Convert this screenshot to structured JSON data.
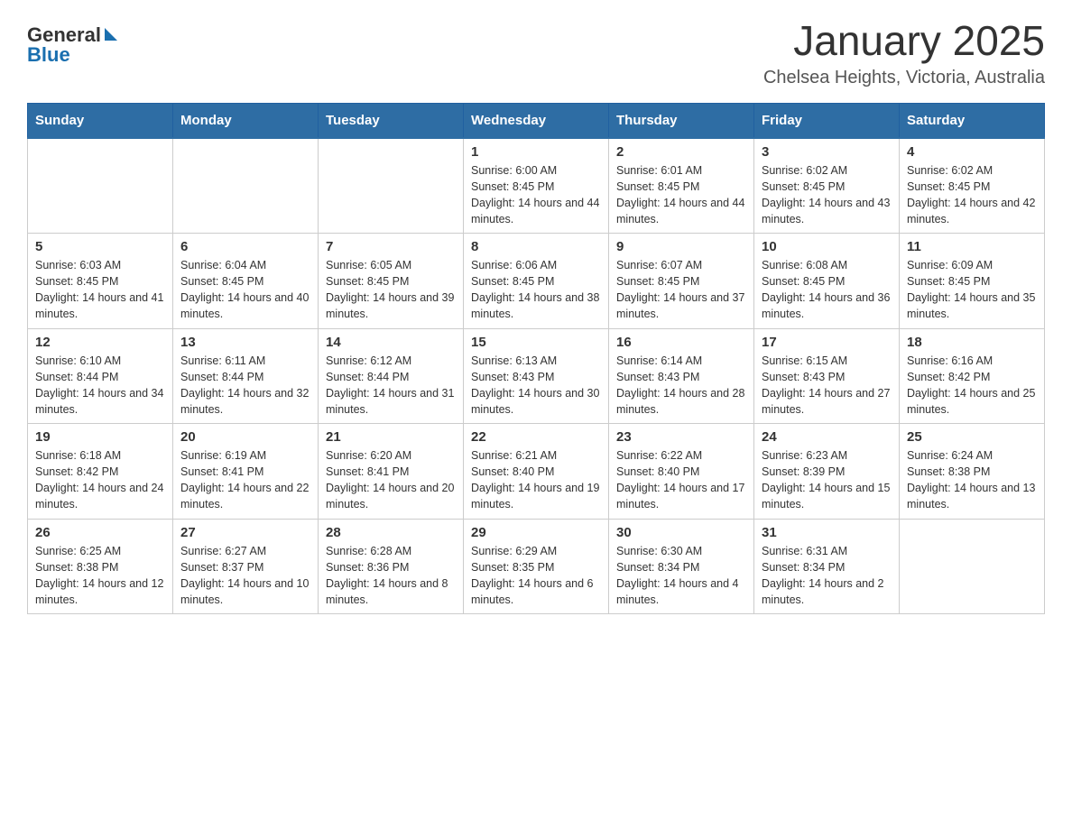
{
  "header": {
    "title": "January 2025",
    "subtitle": "Chelsea Heights, Victoria, Australia",
    "logo_general": "General",
    "logo_blue": "Blue"
  },
  "weekdays": [
    "Sunday",
    "Monday",
    "Tuesday",
    "Wednesday",
    "Thursday",
    "Friday",
    "Saturday"
  ],
  "weeks": [
    [
      {
        "day": "",
        "info": ""
      },
      {
        "day": "",
        "info": ""
      },
      {
        "day": "",
        "info": ""
      },
      {
        "day": "1",
        "info": "Sunrise: 6:00 AM\nSunset: 8:45 PM\nDaylight: 14 hours and 44 minutes."
      },
      {
        "day": "2",
        "info": "Sunrise: 6:01 AM\nSunset: 8:45 PM\nDaylight: 14 hours and 44 minutes."
      },
      {
        "day": "3",
        "info": "Sunrise: 6:02 AM\nSunset: 8:45 PM\nDaylight: 14 hours and 43 minutes."
      },
      {
        "day": "4",
        "info": "Sunrise: 6:02 AM\nSunset: 8:45 PM\nDaylight: 14 hours and 42 minutes."
      }
    ],
    [
      {
        "day": "5",
        "info": "Sunrise: 6:03 AM\nSunset: 8:45 PM\nDaylight: 14 hours and 41 minutes."
      },
      {
        "day": "6",
        "info": "Sunrise: 6:04 AM\nSunset: 8:45 PM\nDaylight: 14 hours and 40 minutes."
      },
      {
        "day": "7",
        "info": "Sunrise: 6:05 AM\nSunset: 8:45 PM\nDaylight: 14 hours and 39 minutes."
      },
      {
        "day": "8",
        "info": "Sunrise: 6:06 AM\nSunset: 8:45 PM\nDaylight: 14 hours and 38 minutes."
      },
      {
        "day": "9",
        "info": "Sunrise: 6:07 AM\nSunset: 8:45 PM\nDaylight: 14 hours and 37 minutes."
      },
      {
        "day": "10",
        "info": "Sunrise: 6:08 AM\nSunset: 8:45 PM\nDaylight: 14 hours and 36 minutes."
      },
      {
        "day": "11",
        "info": "Sunrise: 6:09 AM\nSunset: 8:45 PM\nDaylight: 14 hours and 35 minutes."
      }
    ],
    [
      {
        "day": "12",
        "info": "Sunrise: 6:10 AM\nSunset: 8:44 PM\nDaylight: 14 hours and 34 minutes."
      },
      {
        "day": "13",
        "info": "Sunrise: 6:11 AM\nSunset: 8:44 PM\nDaylight: 14 hours and 32 minutes."
      },
      {
        "day": "14",
        "info": "Sunrise: 6:12 AM\nSunset: 8:44 PM\nDaylight: 14 hours and 31 minutes."
      },
      {
        "day": "15",
        "info": "Sunrise: 6:13 AM\nSunset: 8:43 PM\nDaylight: 14 hours and 30 minutes."
      },
      {
        "day": "16",
        "info": "Sunrise: 6:14 AM\nSunset: 8:43 PM\nDaylight: 14 hours and 28 minutes."
      },
      {
        "day": "17",
        "info": "Sunrise: 6:15 AM\nSunset: 8:43 PM\nDaylight: 14 hours and 27 minutes."
      },
      {
        "day": "18",
        "info": "Sunrise: 6:16 AM\nSunset: 8:42 PM\nDaylight: 14 hours and 25 minutes."
      }
    ],
    [
      {
        "day": "19",
        "info": "Sunrise: 6:18 AM\nSunset: 8:42 PM\nDaylight: 14 hours and 24 minutes."
      },
      {
        "day": "20",
        "info": "Sunrise: 6:19 AM\nSunset: 8:41 PM\nDaylight: 14 hours and 22 minutes."
      },
      {
        "day": "21",
        "info": "Sunrise: 6:20 AM\nSunset: 8:41 PM\nDaylight: 14 hours and 20 minutes."
      },
      {
        "day": "22",
        "info": "Sunrise: 6:21 AM\nSunset: 8:40 PM\nDaylight: 14 hours and 19 minutes."
      },
      {
        "day": "23",
        "info": "Sunrise: 6:22 AM\nSunset: 8:40 PM\nDaylight: 14 hours and 17 minutes."
      },
      {
        "day": "24",
        "info": "Sunrise: 6:23 AM\nSunset: 8:39 PM\nDaylight: 14 hours and 15 minutes."
      },
      {
        "day": "25",
        "info": "Sunrise: 6:24 AM\nSunset: 8:38 PM\nDaylight: 14 hours and 13 minutes."
      }
    ],
    [
      {
        "day": "26",
        "info": "Sunrise: 6:25 AM\nSunset: 8:38 PM\nDaylight: 14 hours and 12 minutes."
      },
      {
        "day": "27",
        "info": "Sunrise: 6:27 AM\nSunset: 8:37 PM\nDaylight: 14 hours and 10 minutes."
      },
      {
        "day": "28",
        "info": "Sunrise: 6:28 AM\nSunset: 8:36 PM\nDaylight: 14 hours and 8 minutes."
      },
      {
        "day": "29",
        "info": "Sunrise: 6:29 AM\nSunset: 8:35 PM\nDaylight: 14 hours and 6 minutes."
      },
      {
        "day": "30",
        "info": "Sunrise: 6:30 AM\nSunset: 8:34 PM\nDaylight: 14 hours and 4 minutes."
      },
      {
        "day": "31",
        "info": "Sunrise: 6:31 AM\nSunset: 8:34 PM\nDaylight: 14 hours and 2 minutes."
      },
      {
        "day": "",
        "info": ""
      }
    ]
  ]
}
